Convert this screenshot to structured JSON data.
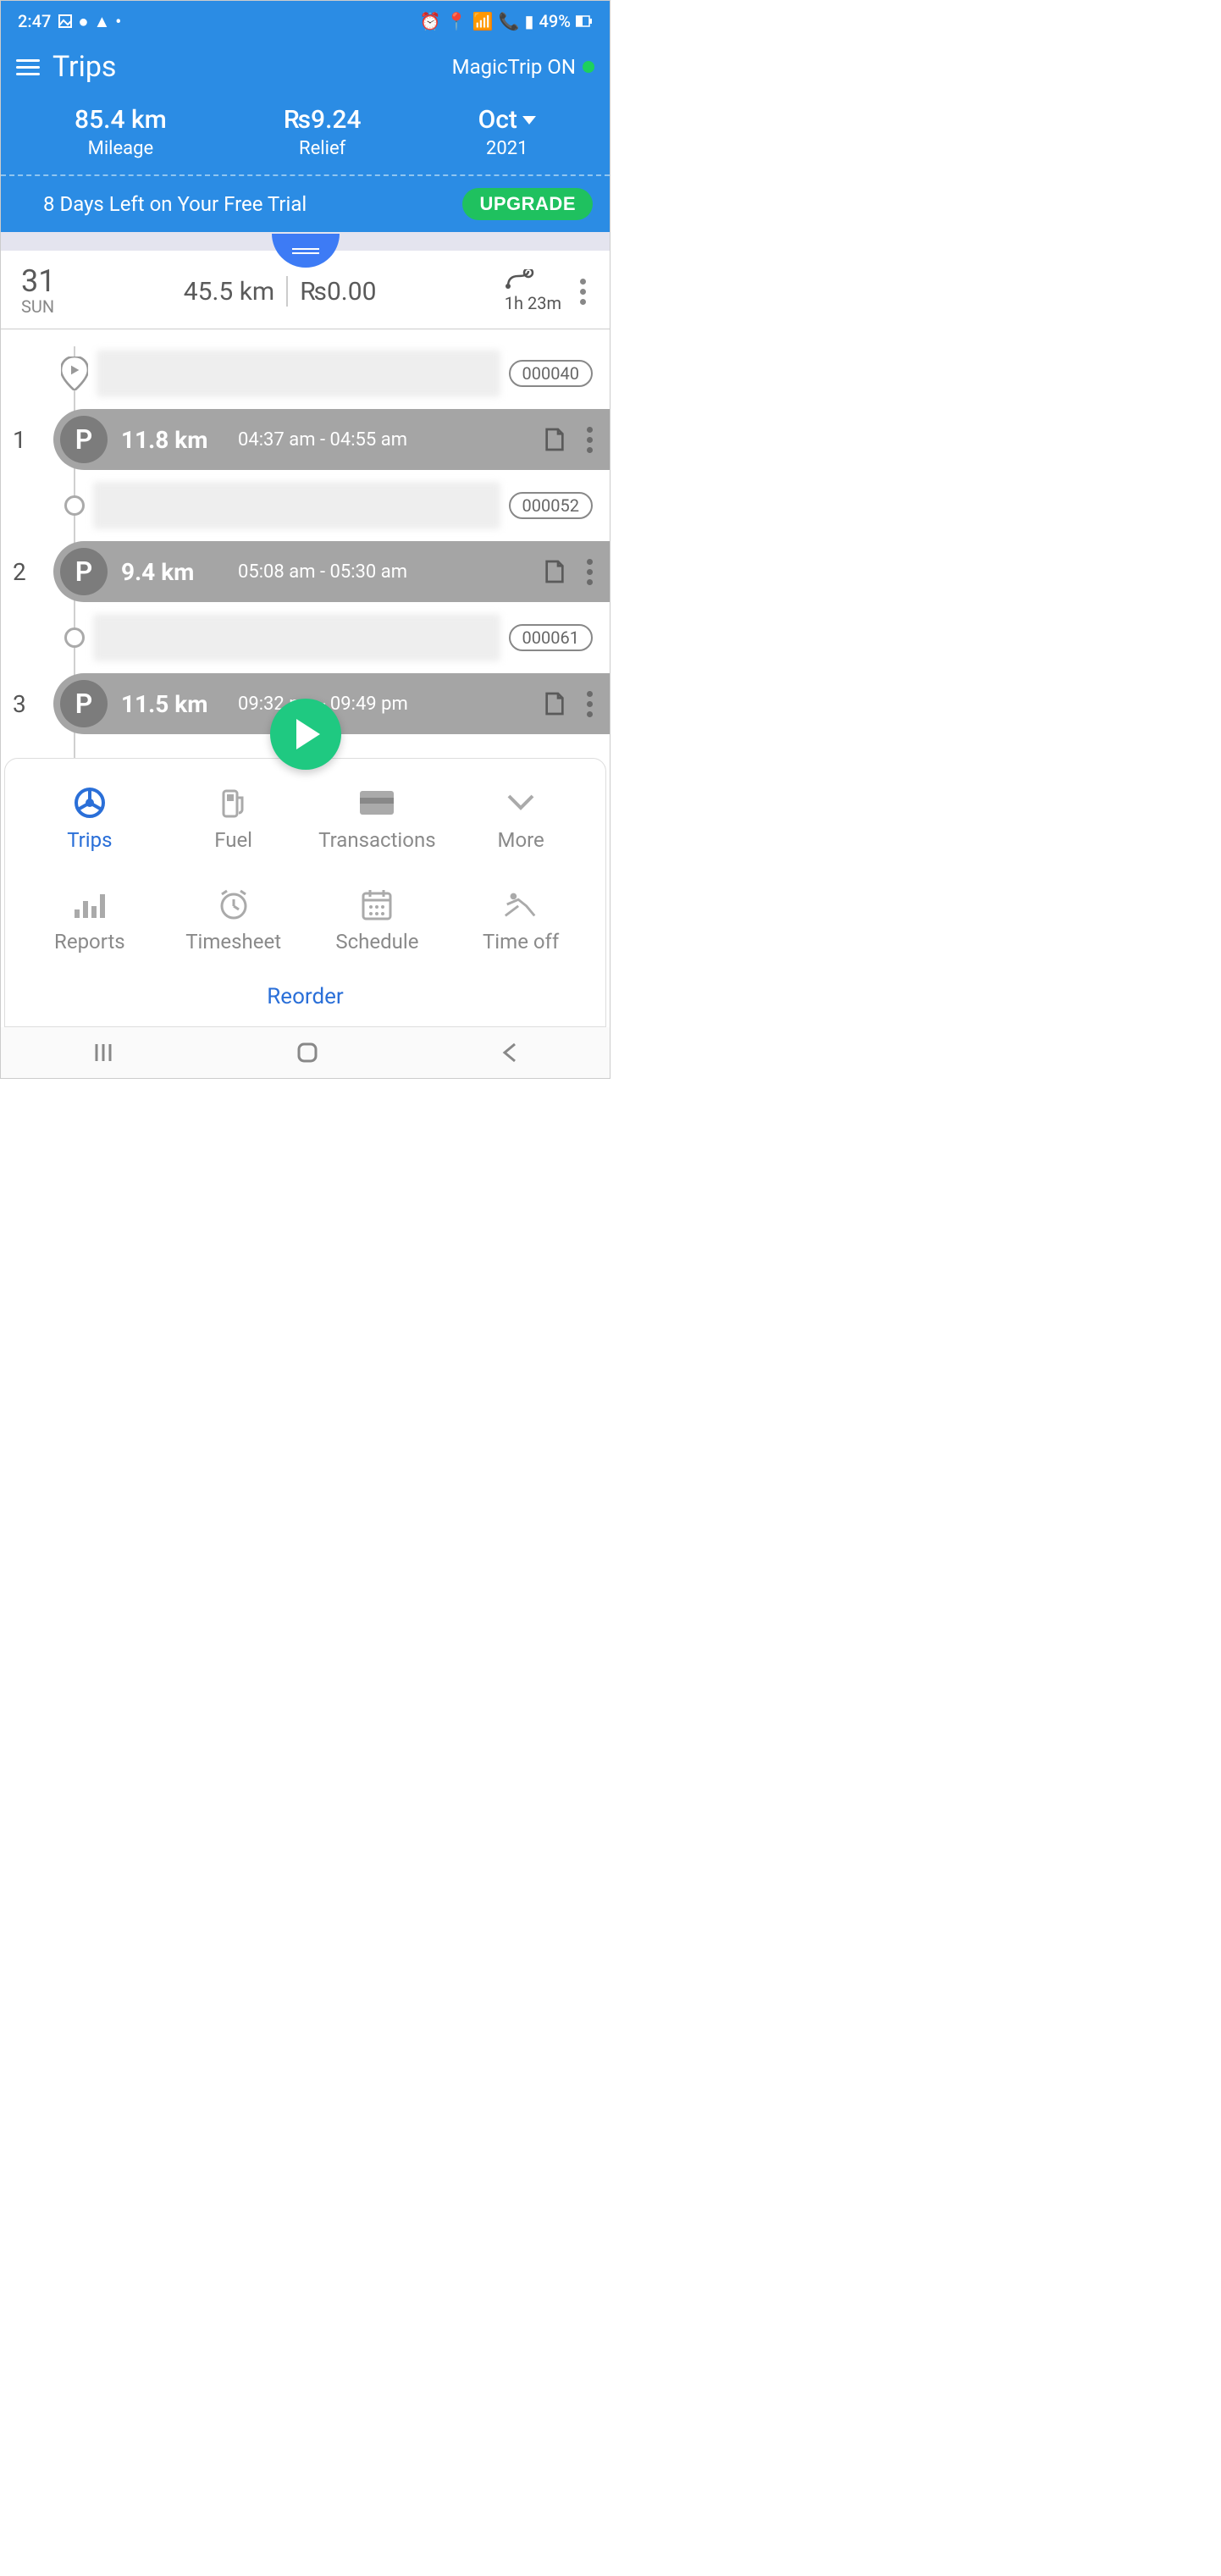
{
  "status_bar": {
    "time": "2:47",
    "battery": "49%"
  },
  "header": {
    "title": "Trips",
    "magic_trip": "MagicTrip ON",
    "mileage_value": "85.4 km",
    "mileage_label": "Mileage",
    "relief_value": "₨9.24",
    "relief_label": "Relief",
    "month_value": "Oct",
    "year_value": "2021"
  },
  "trial": {
    "text": "8 Days Left on Your Free Trial",
    "button": "UPGRADE"
  },
  "day": {
    "date": "31",
    "weekday": "SUN",
    "distance": "45.5 km",
    "amount": "₨0.00",
    "duration": "1h 23m"
  },
  "stops": [
    {
      "code": "000040"
    },
    {
      "code": "000052"
    },
    {
      "code": "000061"
    }
  ],
  "trips": [
    {
      "idx": "1",
      "type": "P",
      "dist": "11.8 km",
      "time": "04:37 am - 04:55 am"
    },
    {
      "idx": "2",
      "type": "P",
      "dist": "9.4 km",
      "time": "05:08 am - 05:30 am"
    },
    {
      "idx": "3",
      "type": "P",
      "dist": "11.5 km",
      "time": "09:32 pm - 09:49 pm"
    }
  ],
  "bottom_nav": {
    "items": [
      {
        "label": "Trips"
      },
      {
        "label": "Fuel"
      },
      {
        "label": "Transactions"
      },
      {
        "label": "More"
      },
      {
        "label": "Reports"
      },
      {
        "label": "Timesheet"
      },
      {
        "label": "Schedule"
      },
      {
        "label": "Time off"
      }
    ],
    "reorder": "Reorder"
  }
}
